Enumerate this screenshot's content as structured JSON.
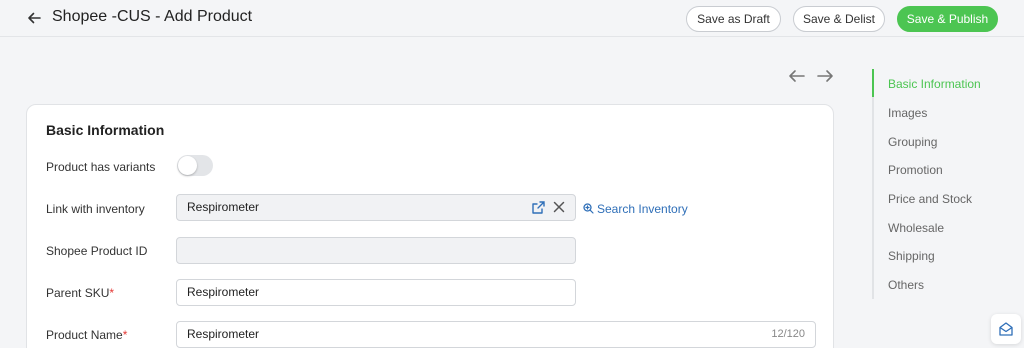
{
  "header": {
    "title": "Shopee -CUS - Add Product",
    "save_draft": "Save as Draft",
    "save_delist": "Save & Delist",
    "save_publish": "Save & Publish"
  },
  "colors": {
    "accent": "#4cc552",
    "link": "#2f6fb8",
    "required": "#e53935"
  },
  "form": {
    "section_title": "Basic Information",
    "variants_label": "Product has variants",
    "variants_enabled": false,
    "inventory_label": "Link with inventory",
    "inventory_value": "Respirometer",
    "search_inventory": "Search Inventory",
    "spid_label": "Shopee Product ID",
    "spid_value": "",
    "sku_label": "Parent SKU",
    "sku_value": "Respirometer",
    "name_label": "Product Name",
    "name_value": "Respirometer",
    "name_count": "12/120",
    "required_mark": "*"
  },
  "sidebar": {
    "items": [
      {
        "label": "Basic Information",
        "active": true
      },
      {
        "label": "Images"
      },
      {
        "label": "Grouping"
      },
      {
        "label": "Promotion"
      },
      {
        "label": "Price and Stock"
      },
      {
        "label": "Wholesale"
      },
      {
        "label": "Shipping"
      },
      {
        "label": "Others"
      }
    ]
  },
  "icons": {
    "back": "arrow-left-icon",
    "prev": "arrow-left-icon",
    "next": "arrow-right-icon",
    "open_link": "external-link-icon",
    "clear": "close-icon",
    "search": "zoom-in-icon",
    "message": "mail-icon"
  }
}
